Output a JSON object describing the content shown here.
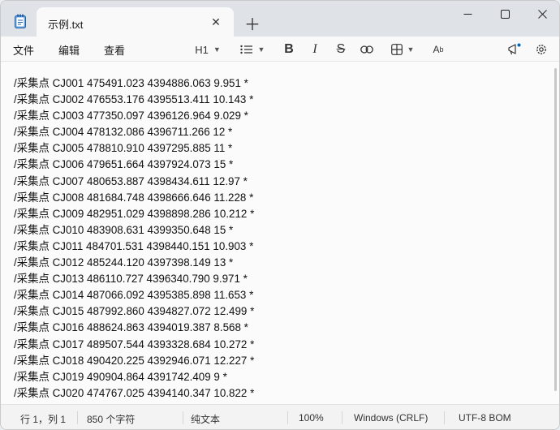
{
  "tab": {
    "title": "示例.txt"
  },
  "menu": {
    "file": "文件",
    "edit": "编辑",
    "view": "查看"
  },
  "toolbar": {
    "heading": "H1"
  },
  "lines": [
    "/采集点 CJ001 475491.023 4394886.063 9.951 *",
    "/采集点 CJ002 476553.176 4395513.411 10.143 *",
    "/采集点 CJ003 477350.097 4396126.964 9.029 *",
    "/采集点 CJ004 478132.086 4396711.266 12 *",
    "/采集点 CJ005 478810.910 4397295.885 11 *",
    "/采集点 CJ006 479651.664 4397924.073 15 *",
    "/采集点 CJ007 480653.887 4398434.611 12.97 *",
    "/采集点 CJ008 481684.748 4398666.646 11.228 *",
    "/采集点 CJ009 482951.029 4398898.286 10.212 *",
    "/采集点 CJ010 483908.631 4399350.648 15 *",
    "/采集点 CJ011 484701.531 4398440.151 10.903 *",
    "/采集点 CJ012 485244.120 4397398.149 13 *",
    "/采集点 CJ013 486110.727 4396340.790 9.971 *",
    "/采集点 CJ014 487066.092 4395385.898 11.653 *",
    "/采集点 CJ015 487992.860 4394827.072 12.499 *",
    "/采集点 CJ016 488624.863 4394019.387 8.568 *",
    "/采集点 CJ017 489507.544 4393328.684 10.272 *",
    "/采集点 CJ018 490420.225 4392946.071 12.227 *",
    "/采集点 CJ019 490904.864 4391742.409 9 *",
    "/采集点 CJ020 474767.025 4394140.347 10.822 *"
  ],
  "status": {
    "position": "行 1，列 1",
    "chars": "850 个字符",
    "format": "纯文本",
    "zoom": "100%",
    "line_ending": "Windows (CRLF)",
    "encoding": "UTF-8 BOM"
  },
  "colors": {
    "accent": "#0067c0",
    "titlebar": "#dfe3e8",
    "editor_bg": "#fbfbfb"
  }
}
